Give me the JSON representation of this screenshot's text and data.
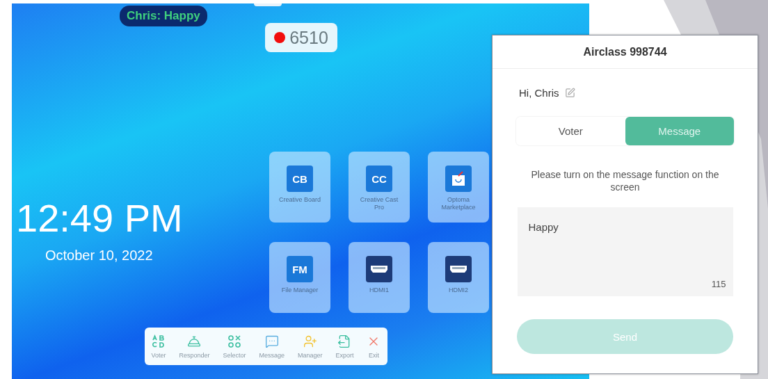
{
  "display": {
    "chat_bubble": "Chris: Happy",
    "counter": {
      "recording": true,
      "value": "6510"
    },
    "clock": {
      "time": "12:49 PM",
      "date": "October 10, 2022"
    },
    "apps": [
      {
        "label": "Creative Board",
        "kind": "badge",
        "badge": "CB"
      },
      {
        "label": "Creative Cast Pro",
        "kind": "badge",
        "badge": "CC"
      },
      {
        "label": "Optoma Marketplace",
        "kind": "bag"
      },
      {
        "label": "File Manager",
        "kind": "badge",
        "badge": "FM"
      },
      {
        "label": "HDMI1",
        "kind": "hdmi"
      },
      {
        "label": "HDMI2",
        "kind": "hdmi"
      }
    ],
    "toolbar": [
      {
        "label": "Voter",
        "kind": "voter",
        "color": "#3cbfa0"
      },
      {
        "label": "Responder",
        "kind": "responder",
        "color": "#3cbfa0"
      },
      {
        "label": "Selector",
        "kind": "selector",
        "color": "#3cbfa0"
      },
      {
        "label": "Message",
        "kind": "message",
        "color": "#5aaee0"
      },
      {
        "label": "Manager",
        "kind": "manager",
        "color": "#f2c230"
      },
      {
        "label": "Export",
        "kind": "export",
        "color": "#3cbfa0"
      },
      {
        "label": "Exit",
        "kind": "exit",
        "color": "#f07a6a"
      }
    ]
  },
  "phone": {
    "title": "Airclass 998744",
    "greeting": "Hi, Chris",
    "tabs": [
      {
        "label": "Voter",
        "selected": false
      },
      {
        "label": "Message",
        "selected": true
      }
    ],
    "hint": "Please turn on the message function on the screen",
    "message": {
      "value": "Happy",
      "remaining": "115"
    },
    "send": {
      "label": "Send",
      "disabled": true
    }
  }
}
